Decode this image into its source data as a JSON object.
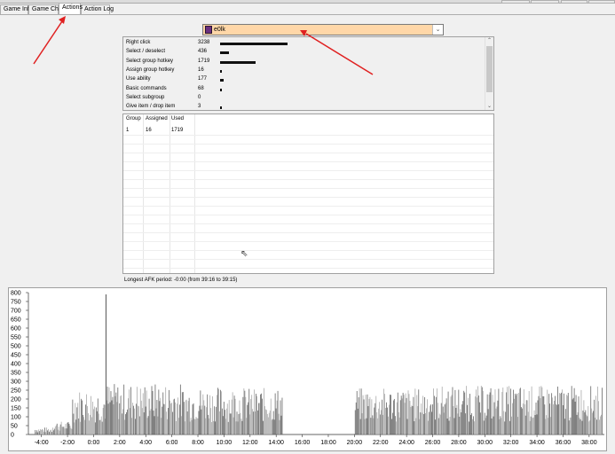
{
  "tabs": [
    {
      "label": "Game Info"
    },
    {
      "label": "Game Chat"
    },
    {
      "label": "Actions"
    },
    {
      "label": "Action Log"
    }
  ],
  "player_select": {
    "value": "e0lk"
  },
  "action_stats": [
    {
      "label": "Right click",
      "value": "3238",
      "amount": 3238
    },
    {
      "label": "Select / deselect",
      "value": "436",
      "amount": 436
    },
    {
      "label": "Select group hotkey",
      "value": "1719",
      "amount": 1719
    },
    {
      "label": "Assign group hotkey",
      "value": "16",
      "amount": 16
    },
    {
      "label": "Use ability",
      "value": "177",
      "amount": 177
    },
    {
      "label": "Basic commands",
      "value": "68",
      "amount": 68
    },
    {
      "label": "Select subgroup",
      "value": "0",
      "amount": 0
    },
    {
      "label": "Give item / drop item",
      "value": "3",
      "amount": 3
    }
  ],
  "group_table": {
    "headers": [
      "Group",
      "Assigned",
      "Used"
    ],
    "rows": [
      [
        "1",
        "16",
        "1719"
      ]
    ]
  },
  "afk_text": "Longest AFK period:  -0:00 (from 39:16 to 39:15)",
  "colors": {
    "highlight": "#ffd7a8",
    "annotation_arrow": "#e02020",
    "bar_dark": "#111111",
    "chart_bar": "#666666",
    "chart_bar_light": "#aaaaaa"
  },
  "chart_data": {
    "type": "bar",
    "title": "",
    "xlabel": "",
    "ylabel": "",
    "ylim": [
      0,
      800
    ],
    "xlim": [
      -300,
      2350
    ],
    "yticks": [
      0,
      50,
      100,
      150,
      200,
      250,
      300,
      350,
      400,
      450,
      500,
      550,
      600,
      650,
      700,
      750,
      800
    ],
    "xtick_labels": [
      "-4:00",
      "-2:00",
      "0:00",
      "2:00",
      "4:00",
      "6:00",
      "8:00",
      "10:00",
      "12:00",
      "14:00",
      "16:00",
      "18:00",
      "20:00",
      "22:00",
      "24:00",
      "26:00",
      "28:00",
      "30:00",
      "32:00",
      "34:00",
      "36:00",
      "38:00"
    ],
    "xtick_values": [
      -240,
      -120,
      0,
      120,
      240,
      360,
      480,
      600,
      720,
      840,
      960,
      1080,
      1200,
      1320,
      1440,
      1560,
      1680,
      1800,
      1920,
      2040,
      2160,
      2280
    ],
    "segments": [
      {
        "x_start": -270,
        "x_end": -190,
        "level": 30
      },
      {
        "x_start": -190,
        "x_end": -100,
        "level": 55
      },
      {
        "x_start": -100,
        "x_end": 60,
        "level": 190
      },
      {
        "x_start": 60,
        "x_end": 400,
        "level": 215
      },
      {
        "x_start": 400,
        "x_end": 700,
        "level": 200
      },
      {
        "x_start": 700,
        "x_end": 870,
        "level": 195
      },
      {
        "x_start": 870,
        "x_end": 1200,
        "level": 0
      },
      {
        "x_start": 1200,
        "x_end": 1520,
        "level": 195
      },
      {
        "x_start": 1520,
        "x_end": 2340,
        "level": 205
      }
    ],
    "peak": {
      "x": 55,
      "y": 790
    }
  }
}
